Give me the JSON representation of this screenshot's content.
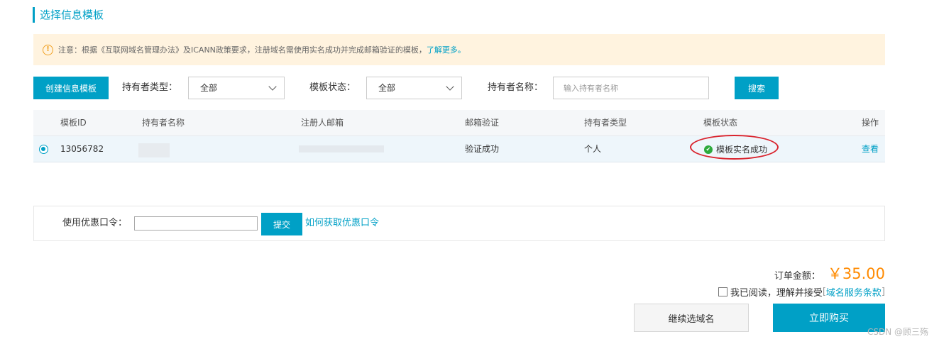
{
  "section_title": "选择信息模板",
  "notice": {
    "icon": "info-icon",
    "text": "注意：根据《互联网域名管理办法》及ICANN政策要求，注册域名需使用实名成功并完成邮箱验证的模板，",
    "link": "了解更多。"
  },
  "filters": {
    "create_button": "创建信息模板",
    "holder_type_label": "持有者类型：",
    "holder_type_value": "全部",
    "template_status_label": "模板状态：",
    "template_status_value": "全部",
    "holder_name_label": "持有者名称：",
    "holder_name_placeholder": "输入持有者名称",
    "search_button": "搜索"
  },
  "table": {
    "headers": {
      "id": "模板ID",
      "holder_name": "持有者名称",
      "email": "注册人邮箱",
      "email_verify": "邮箱验证",
      "holder_type": "持有者类型",
      "status": "模板状态",
      "action": "操作"
    },
    "rows": [
      {
        "selected": true,
        "id": "13056782",
        "email_verify": "验证成功",
        "holder_type": "个人",
        "status": "模板实名成功",
        "action": "查看"
      }
    ]
  },
  "coupon": {
    "label": "使用优惠口令：",
    "value": "",
    "submit": "提交",
    "help_link": "如何获取优惠口令"
  },
  "order": {
    "label": "订单金额：",
    "amount": "￥35.00"
  },
  "agreement": {
    "text": "我已阅读，理解并接受",
    "bracket_open": "[",
    "term": "域名服务条款",
    "bracket_close": "]"
  },
  "buttons": {
    "continue": "继续选域名",
    "buy": "立即购买"
  },
  "watermark": "CSDN @顾三殇",
  "colors": {
    "accent": "#00a0c6",
    "price": "#ff8a00",
    "notice_bg": "#fff3df",
    "success": "#2eaa3c",
    "annotation": "#d9232d"
  }
}
